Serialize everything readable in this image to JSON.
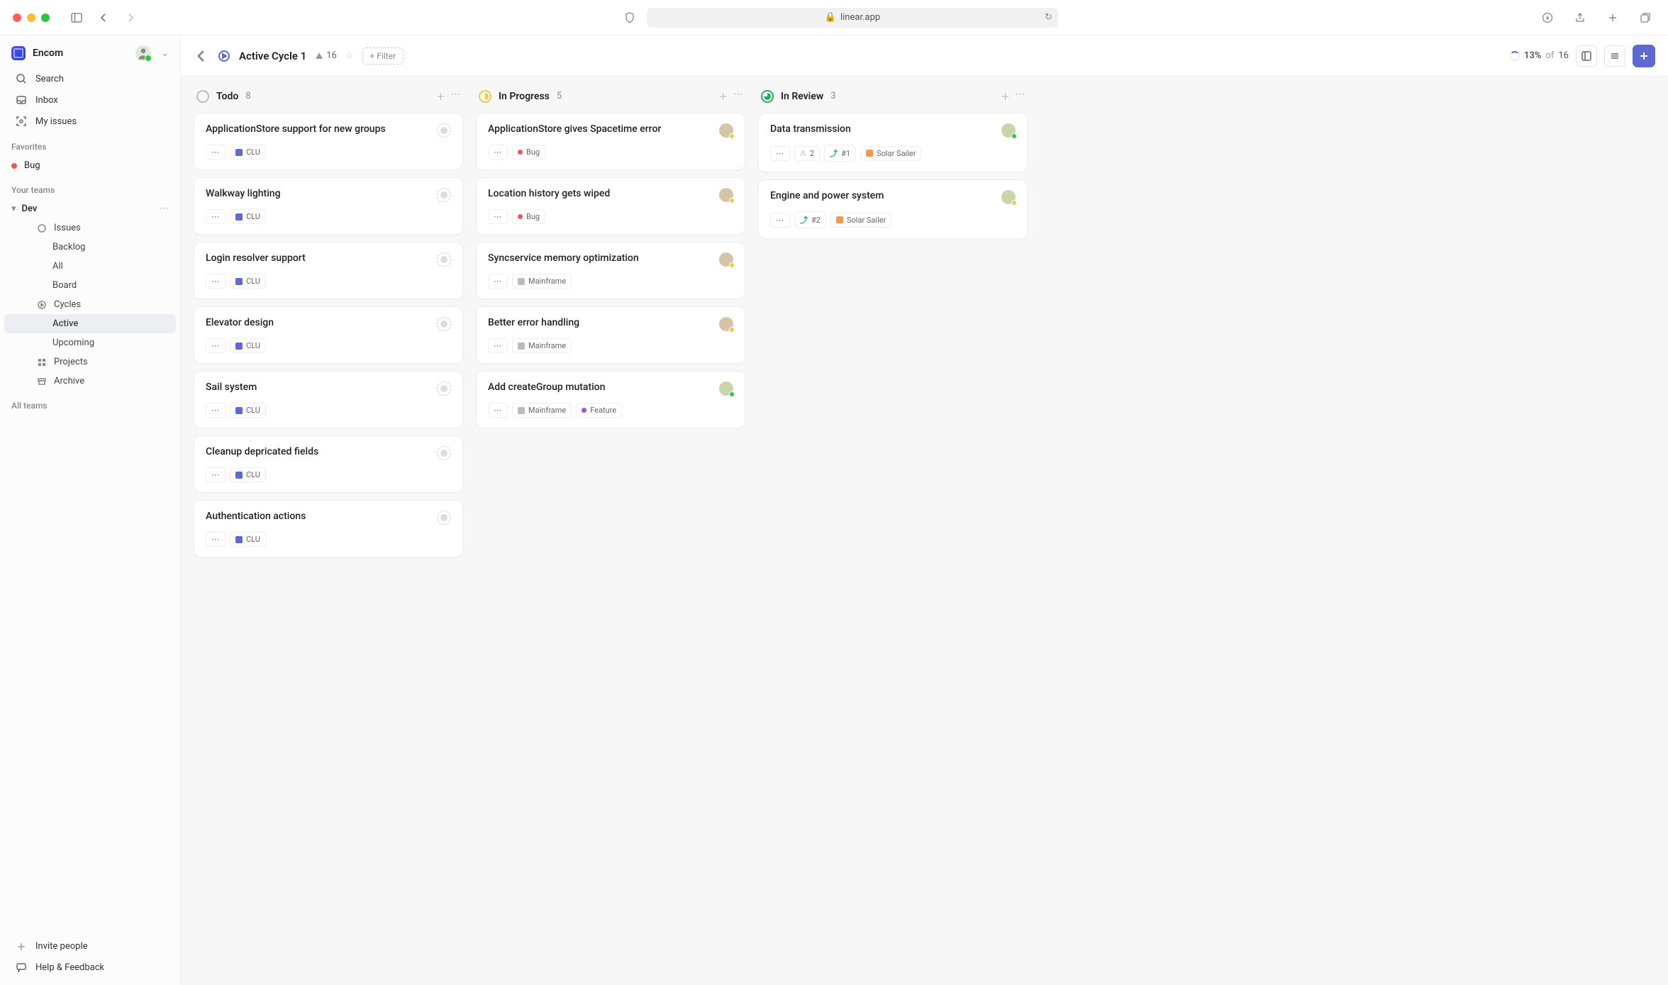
{
  "browser": {
    "url": "linear.app"
  },
  "workspace": {
    "name": "Encom"
  },
  "nav": {
    "search": "Search",
    "inbox": "Inbox",
    "myIssues": "My issues"
  },
  "favorites": {
    "label": "Favorites",
    "bug": "Bug"
  },
  "teams": {
    "label": "Your teams",
    "dev": "Dev",
    "issues": "Issues",
    "backlog": "Backlog",
    "all": "All",
    "board": "Board",
    "cycles": "Cycles",
    "active": "Active",
    "upcoming": "Upcoming",
    "projects": "Projects",
    "archive": "Archive",
    "allTeams": "All teams"
  },
  "sidebarFooter": {
    "invite": "Invite people",
    "help": "Help & Feedback"
  },
  "header": {
    "title": "Active Cycle 1",
    "scopeCount": "16",
    "filter": "+ Filter",
    "progressPercent": "13%",
    "of": "of",
    "total": "16"
  },
  "columns": [
    {
      "id": "todo",
      "name": "Todo",
      "count": "8",
      "statusClass": "status-todo",
      "cards": [
        {
          "title": "ApplicationStore support for new groups",
          "project": "CLU",
          "projectClass": "",
          "avatar": "unassigned"
        },
        {
          "title": "Walkway lighting",
          "project": "CLU",
          "projectClass": "",
          "avatar": "unassigned"
        },
        {
          "title": "Login resolver support",
          "project": "CLU",
          "projectClass": "",
          "avatar": "unassigned"
        },
        {
          "title": "Elevator design",
          "project": "CLU",
          "projectClass": "",
          "avatar": "unassigned"
        },
        {
          "title": "Sail system",
          "project": "CLU",
          "projectClass": "",
          "avatar": "unassigned"
        },
        {
          "title": "Cleanup depricated fields",
          "project": "CLU",
          "projectClass": "",
          "avatar": "unassigned"
        },
        {
          "title": "Authentication actions",
          "project": "CLU",
          "projectClass": "",
          "avatar": "unassigned"
        }
      ]
    },
    {
      "id": "inprogress",
      "name": "In Progress",
      "count": "5",
      "statusClass": "status-progress",
      "cards": [
        {
          "title": "ApplicationStore gives Spacetime error",
          "label": "Bug",
          "labelClass": "red",
          "avatar": "user1",
          "presence": "away"
        },
        {
          "title": "Location history gets wiped",
          "label": "Bug",
          "labelClass": "red",
          "avatar": "user1",
          "presence": "away"
        },
        {
          "title": "Syncservice memory optimization",
          "project": "Mainframe",
          "projectClass": "gray",
          "avatar": "user1",
          "presence": "away"
        },
        {
          "title": "Better error handling",
          "project": "Mainframe",
          "projectClass": "gray",
          "avatar": "user1",
          "presence": "away"
        },
        {
          "title": "Add createGroup mutation",
          "project": "Mainframe",
          "projectClass": "gray",
          "label": "Feature",
          "labelClass": "purple",
          "avatar": "user2",
          "presence": "online"
        }
      ]
    },
    {
      "id": "inreview",
      "name": "In Review",
      "count": "3",
      "statusClass": "status-review",
      "cards": [
        {
          "title": "Data transmission",
          "warn": "2",
          "pr": "#1",
          "project": "Solar Sailer",
          "projectClass": "orange",
          "avatar": "user2",
          "presence": "online"
        },
        {
          "title": "Engine and power system",
          "pr": "#2",
          "project": "Solar Sailer",
          "projectClass": "orange",
          "avatar": "user2",
          "presence": "away"
        }
      ]
    }
  ]
}
